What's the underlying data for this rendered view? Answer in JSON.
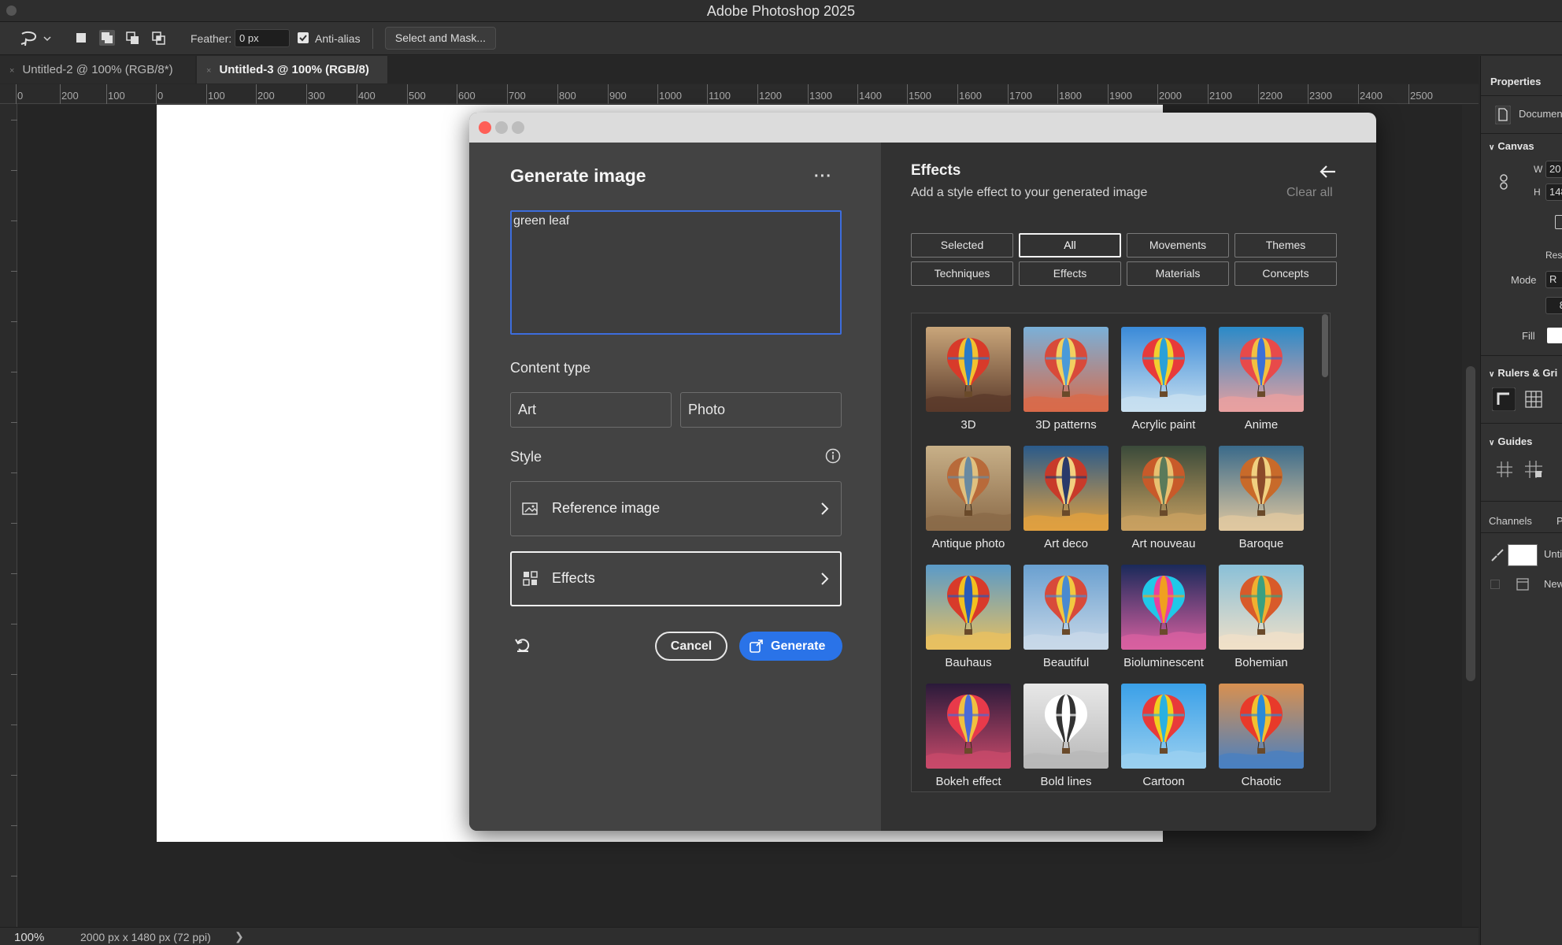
{
  "app_title": "Adobe Photoshop 2025",
  "options_bar": {
    "feather_label": "Feather:",
    "feather_value": "0 px",
    "anti_alias_label": "Anti-alias",
    "anti_alias_checked": true,
    "select_and_mask_label": "Select and Mask..."
  },
  "tabs": [
    {
      "label": "Untitled-2 @ 100% (RGB/8*)",
      "active": false
    },
    {
      "label": "Untitled-3 @ 100% (RGB/8)",
      "active": true
    }
  ],
  "ruler_labels": [
    "0",
    "200",
    "100",
    "0",
    "100",
    "200",
    "300",
    "400",
    "500",
    "600",
    "700",
    "800",
    "900",
    "1000",
    "1100",
    "1200",
    "1300",
    "1400",
    "1500",
    "1600",
    "1700",
    "1800",
    "1900",
    "2000",
    "2100",
    "2200",
    "2300",
    "2400",
    "2500"
  ],
  "status": {
    "zoom": "100%",
    "doc_info": "2000 px x 1480 px (72 ppi)",
    "arrow": "❯"
  },
  "properties_panel": {
    "tab": "Properties",
    "document_label": "Documen",
    "canvas_section": "Canvas",
    "w_label": "W",
    "w_value": "20",
    "h_label": "H",
    "h_value": "148",
    "res_label": "Res",
    "mode_label": "Mode",
    "mode_value": "R",
    "depth_value": "8",
    "fill_label": "Fill",
    "rulers_section": "Rulers & Gri",
    "guides_section": "Guides",
    "channels_tab": "Channels",
    "next_tab": "P",
    "layer1_label": "Unti",
    "layer2_label": "New"
  },
  "dialog": {
    "title": "Generate image",
    "more": "···",
    "prompt_text": "green leaf",
    "content_type_label": "Content type",
    "content_types": [
      "Art",
      "Photo"
    ],
    "style_label": "Style",
    "reference_image_label": "Reference image",
    "effects_label": "Effects",
    "cancel_label": "Cancel",
    "generate_label": "Generate"
  },
  "effects_panel": {
    "title": "Effects",
    "subtitle": "Add a style effect to your generated image",
    "clear_all": "Clear all",
    "chips": [
      {
        "label": "Selected",
        "active": false
      },
      {
        "label": "All",
        "active": true
      },
      {
        "label": "Movements",
        "active": false
      },
      {
        "label": "Themes",
        "active": false
      },
      {
        "label": "Techniques",
        "active": false
      },
      {
        "label": "Effects",
        "active": false
      },
      {
        "label": "Materials",
        "active": false
      },
      {
        "label": "Concepts",
        "active": false
      }
    ],
    "tiles": [
      {
        "label": "3D",
        "sky": [
          "#c9a67a",
          "#5a3a2a"
        ],
        "balloon": [
          "#d83a2a",
          "#f2c230",
          "#2a7ac8"
        ]
      },
      {
        "label": "3D patterns",
        "sky": [
          "#7ab0d8",
          "#d86a4a"
        ],
        "balloon": [
          "#d84a3a",
          "#f2d060",
          "#4a9ad8"
        ]
      },
      {
        "label": "Acrylic paint",
        "sky": [
          "#3a8ad8",
          "#c8e0f0"
        ],
        "balloon": [
          "#e83a3a",
          "#f2d030",
          "#2aa0d8"
        ]
      },
      {
        "label": "Anime",
        "sky": [
          "#2a8ac8",
          "#e8a0a0"
        ],
        "balloon": [
          "#e84a4a",
          "#f2c040",
          "#3a70d8"
        ]
      },
      {
        "label": "Antique photo",
        "sky": [
          "#c8b088",
          "#8a6a48"
        ],
        "balloon": [
          "#b86a3a",
          "#e0c080",
          "#6a8aa0"
        ]
      },
      {
        "label": "Art deco",
        "sky": [
          "#2a5a8a",
          "#e0a040"
        ],
        "balloon": [
          "#c83a2a",
          "#f2d080",
          "#2a3a6a"
        ]
      },
      {
        "label": "Art nouveau",
        "sky": [
          "#3a4a3a",
          "#c8a060"
        ],
        "balloon": [
          "#c85a2a",
          "#e8c070",
          "#5a7a5a"
        ]
      },
      {
        "label": "Baroque",
        "sky": [
          "#3a6a8a",
          "#e0c8a0"
        ],
        "balloon": [
          "#c86a2a",
          "#f0d080",
          "#8a4a2a"
        ]
      },
      {
        "label": "Bauhaus",
        "sky": [
          "#5a9ac8",
          "#e8c060"
        ],
        "balloon": [
          "#d83a2a",
          "#f2c020",
          "#2a5ab8"
        ]
      },
      {
        "label": "Beautiful",
        "sky": [
          "#6aa0d0",
          "#c8d8e8"
        ],
        "balloon": [
          "#d84a3a",
          "#f2c840",
          "#4a8ad0"
        ]
      },
      {
        "label": "Bioluminescent",
        "sky": [
          "#1a2a5a",
          "#d860a0"
        ],
        "balloon": [
          "#20c8e8",
          "#e840a0",
          "#f0a020"
        ]
      },
      {
        "label": "Bohemian",
        "sky": [
          "#8ac0d8",
          "#f0e0c8"
        ],
        "balloon": [
          "#d85a2a",
          "#f0b030",
          "#3aa080"
        ]
      },
      {
        "label": "Bokeh effect",
        "sky": [
          "#2a1a3a",
          "#c84a6a"
        ],
        "balloon": [
          "#e83a4a",
          "#f0c040",
          "#4a6ad8"
        ]
      },
      {
        "label": "Bold lines",
        "sky": [
          "#e8e8e8",
          "#b8b8b8"
        ],
        "balloon": [
          "#ffffff",
          "#333333",
          "#ffffff"
        ]
      },
      {
        "label": "Cartoon",
        "sky": [
          "#3aa0e8",
          "#9ad0f0"
        ],
        "balloon": [
          "#e83a3a",
          "#f2d020",
          "#2ab0e0"
        ]
      },
      {
        "label": "Chaotic",
        "sky": [
          "#d89050",
          "#4a80c0"
        ],
        "balloon": [
          "#e83a2a",
          "#f2c030",
          "#2a8ad8"
        ]
      }
    ]
  }
}
